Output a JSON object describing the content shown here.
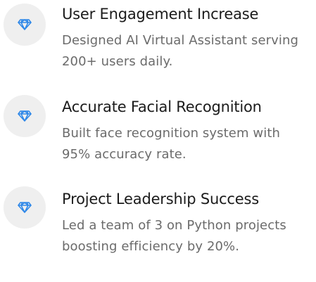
{
  "achievements": [
    {
      "icon": "diamond-icon",
      "title": "User Engagement Increase",
      "description": "Designed AI Virtual Assistant serving 200+ users daily."
    },
    {
      "icon": "diamond-icon",
      "title": "Accurate Facial Recognition",
      "description": "Built face recognition system with 95% accuracy rate."
    },
    {
      "icon": "diamond-icon",
      "title": "Project Leadership Success",
      "description": "Led a team of 3 on Python projects boosting efficiency by 20%."
    }
  ],
  "colors": {
    "icon": "#2f88e8",
    "icon_background": "#efefef",
    "title": "#1b1b1b",
    "description": "#6b6b6b"
  }
}
